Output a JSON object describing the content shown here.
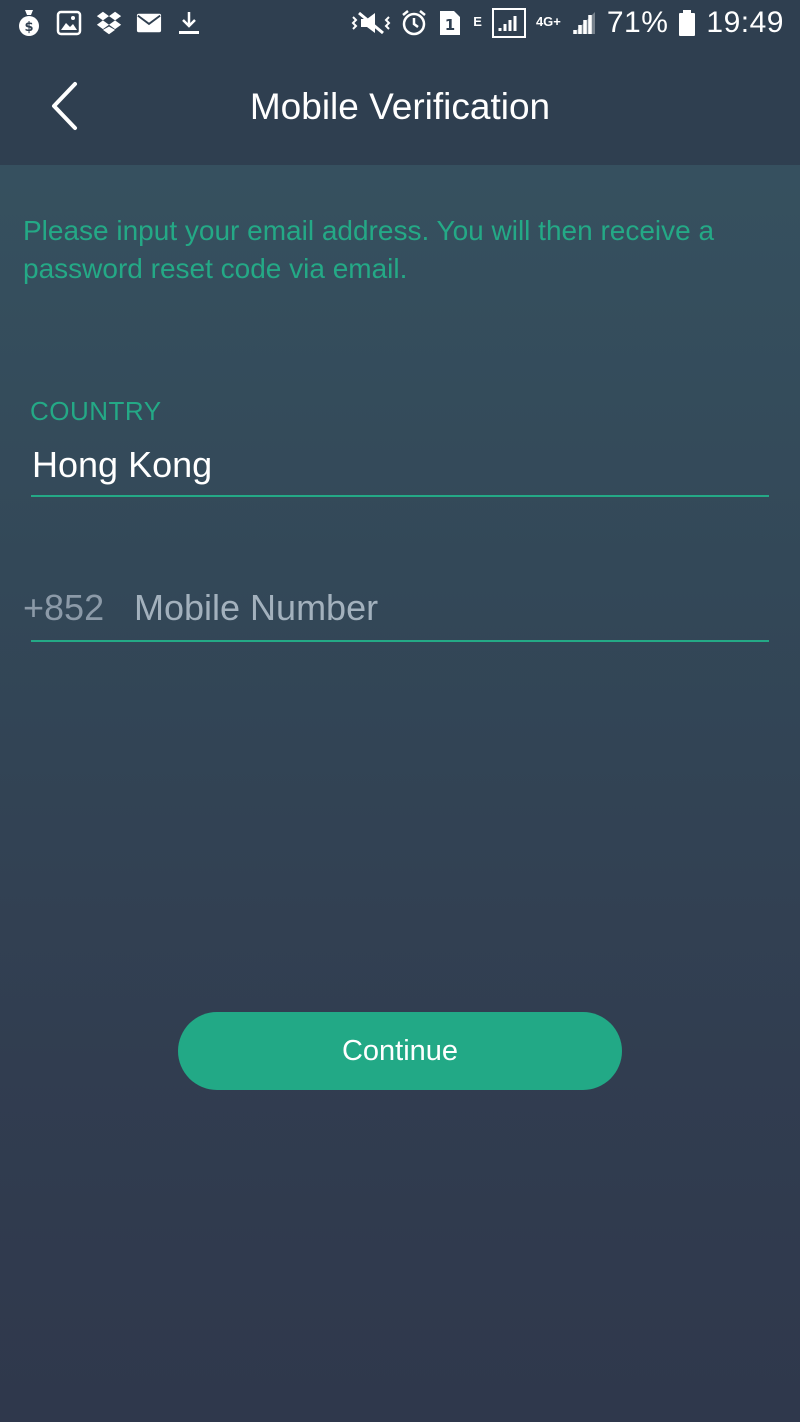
{
  "status_bar": {
    "left_icons": [
      "money-bag-icon",
      "gallery-icon",
      "dropbox-icon",
      "mail-icon",
      "download-icon"
    ],
    "right_icons": [
      "vibrate-mute-icon",
      "alarm-icon",
      "sim-1-icon",
      "network-e-icon",
      "signal-sim1-icon",
      "network-4g-plus-icon",
      "signal-sim2-icon",
      "battery-icon"
    ],
    "network_e": "E",
    "network_4g": "4G+",
    "sim_label": "1",
    "battery_percent": "71%",
    "time": "19:49"
  },
  "app_bar": {
    "title": "Mobile Verification",
    "back_icon": "chevron-left-icon"
  },
  "instructions": "Please input your email address. You will then receive a password reset code via email.",
  "country": {
    "label": "COUNTRY",
    "value": "Hong Kong"
  },
  "phone": {
    "prefix": "+852",
    "value": "",
    "placeholder": "Mobile Number"
  },
  "continue_label": "Continue",
  "colors": {
    "accent": "#24a986",
    "button": "#22a986",
    "app_bar": "#2f3f50",
    "placeholder": "#a3b1bd",
    "prefix": "#8c9aa8"
  }
}
